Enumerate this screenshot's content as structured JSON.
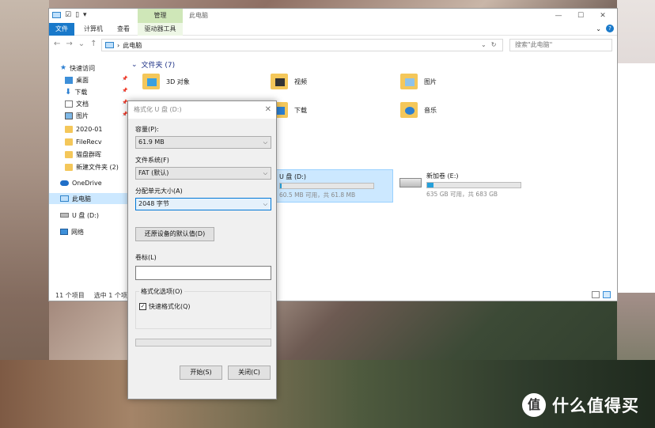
{
  "explorer": {
    "manage_tab": "管理",
    "window_title": "此电脑",
    "ribbon": {
      "file": "文件",
      "computer": "计算机",
      "view": "查看",
      "drive_tools": "驱动器工具"
    },
    "address": {
      "path": "此电脑",
      "search_placeholder": "搜索\"此电脑\""
    },
    "nav": {
      "quick_access": "快速访问",
      "items": [
        {
          "label": "桌面",
          "pinned": true
        },
        {
          "label": "下载",
          "pinned": true
        },
        {
          "label": "文档",
          "pinned": true
        },
        {
          "label": "图片",
          "pinned": true
        },
        {
          "label": "2020-01",
          "pinned": false
        },
        {
          "label": "FileRecv",
          "pinned": false
        },
        {
          "label": "猫盘群晖",
          "pinned": false
        },
        {
          "label": "新建文件夹 (2)",
          "pinned": false
        }
      ],
      "onedrive": "OneDrive",
      "this_pc": "此电脑",
      "usb": "U 盘 (D:)",
      "network": "网络"
    },
    "content": {
      "folders_header": "文件夹 (7)",
      "folders": [
        "3D 对象",
        "视频",
        "图片",
        "下载",
        "音乐"
      ],
      "drives": [
        {
          "name": "U 盘 (D:)",
          "free_text": "60.5 MB 可用，共 61.8 MB",
          "used_fraction": 0.02,
          "selected": true
        },
        {
          "name": "新加卷 (E:)",
          "free_text": "635 GB 可用，共 683 GB",
          "used_fraction": 0.07,
          "selected": false
        }
      ]
    },
    "status": {
      "count": "11 个项目",
      "selected": "选中 1 个项目"
    }
  },
  "dialog": {
    "title": "格式化 U 盘 (D:)",
    "capacity_label": "容量(P):",
    "capacity_value": "61.9 MB",
    "fs_label": "文件系统(F)",
    "fs_value": "FAT (默认)",
    "alloc_label": "分配单元大小(A)",
    "alloc_value": "2048 字节",
    "restore_btn": "还原设备的默认值(D)",
    "volume_label": "卷标(L)",
    "volume_value": "",
    "options_label": "格式化选项(O)",
    "quick_format": "快速格式化(Q)",
    "quick_format_checked": true,
    "start_btn": "开始(S)",
    "close_btn": "关闭(C)"
  },
  "watermark": {
    "logo": "值",
    "text": "什么值得买"
  }
}
